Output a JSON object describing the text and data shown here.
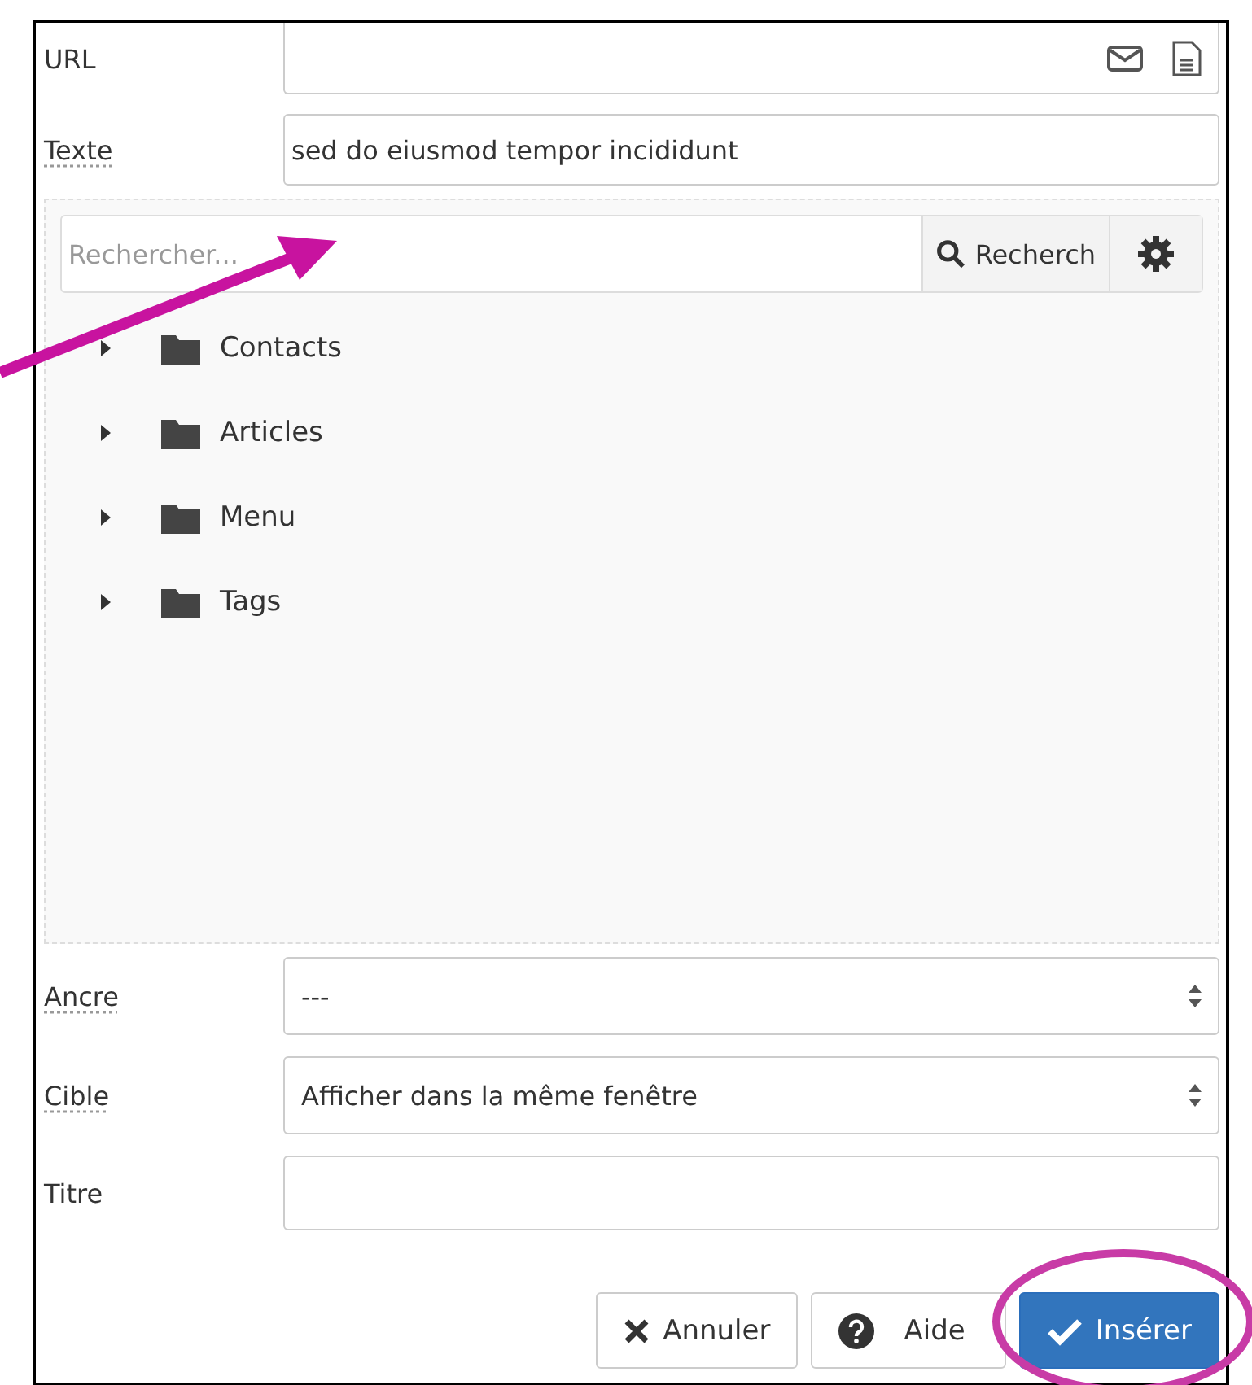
{
  "fields_top": [
    {
      "kind": "url",
      "label": "URL",
      "abbr": false
    },
    {
      "kind": "text",
      "label": "Texte",
      "value": "sed do eiusmod tempor incididunt",
      "abbr": true
    }
  ],
  "browser": {
    "search": {
      "placeholder": "Rechercher...",
      "button": "Recherch"
    },
    "tree": [
      {
        "label": "Contacts",
        "expanded": false
      },
      {
        "label": "Articles",
        "expanded": false
      },
      {
        "label": "Menu",
        "expanded": false
      },
      {
        "label": "Tags",
        "expanded": false
      }
    ]
  },
  "fields_bottom": [
    {
      "kind": "select",
      "label": "Ancre",
      "value": "---",
      "abbr": true
    },
    {
      "kind": "select",
      "label": "Cible",
      "value": "Afficher dans la même fenêtre",
      "abbr": true
    },
    {
      "kind": "text",
      "label": "Titre",
      "abbr": false
    }
  ],
  "buttons": [
    {
      "kind": "cancel",
      "label": "Annuler"
    },
    {
      "kind": "help",
      "label": "Aide"
    },
    {
      "kind": "insert",
      "label": "Insérer"
    }
  ]
}
